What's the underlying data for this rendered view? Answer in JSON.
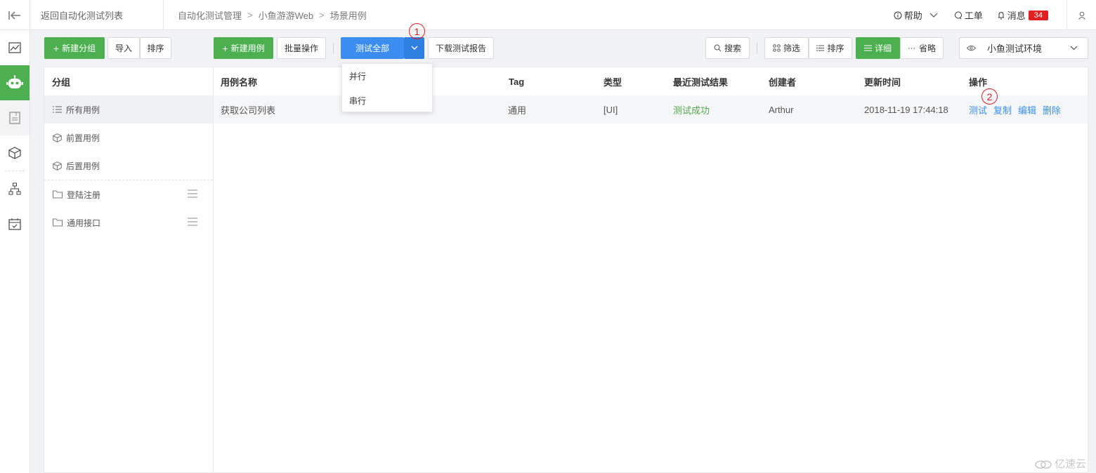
{
  "header": {
    "back_label": "返回自动化测试列表",
    "breadcrumb": [
      "自动化测试管理",
      "小鱼游游Web",
      "场景用例"
    ],
    "help": "帮助",
    "ticket": "工单",
    "messages": "消息",
    "message_count": "34"
  },
  "nav": {
    "icons": [
      "chart-icon",
      "robot-icon",
      "document-icon",
      "cube-icon",
      "hierarchy-icon",
      "calendar-check-icon"
    ],
    "active_index": 1
  },
  "toolbar": {
    "new_group": "新建分组",
    "import": "导入",
    "sort_groups": "排序",
    "new_case": "新建用例",
    "batch": "批量操作",
    "test_all": "测试全部",
    "download_report": "下载测试报告",
    "search": "搜索",
    "filter": "筛选",
    "sort": "排序",
    "detail": "详细",
    "brief": "省略",
    "environment": "小鱼测试环境"
  },
  "dropdown": {
    "items": [
      "并行",
      "串行"
    ]
  },
  "groups": {
    "title": "分组",
    "items": [
      {
        "label": "所有用例",
        "icon": "list-icon",
        "active": true
      },
      {
        "label": "前置用例",
        "icon": "cube-icon"
      },
      {
        "label": "后置用例",
        "icon": "cube-icon"
      },
      {
        "label": "登陆注册",
        "icon": "folder-icon",
        "menu": true
      },
      {
        "label": "通用接口",
        "icon": "folder-icon",
        "menu": true
      }
    ]
  },
  "table": {
    "columns": [
      "用例名称",
      "Tag",
      "类型",
      "最近测试结果",
      "创建者",
      "更新时间",
      "操作"
    ],
    "rows": [
      {
        "name": "获取公司列表",
        "tag": "通用",
        "type": "[UI]",
        "result": "测试成功",
        "creator": "Arthur",
        "updated": "2018-11-19 17:44:18",
        "actions": [
          "测试",
          "复制",
          "编辑",
          "删除"
        ]
      }
    ]
  },
  "annotations": {
    "marker1": "1",
    "marker2": "2"
  },
  "watermark": "亿速云",
  "colors": {
    "green": "#4caf50",
    "blue": "#3b8ef0",
    "success": "#52a84a",
    "badge": "#e02020"
  }
}
